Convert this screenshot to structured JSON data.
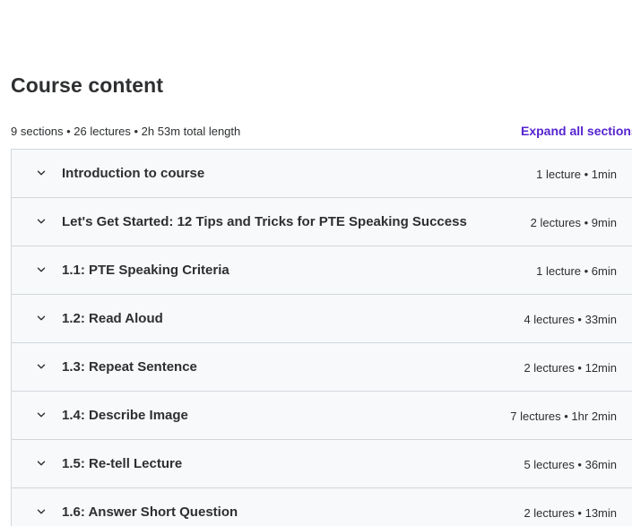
{
  "header": {
    "title": "Course content",
    "summary": "9 sections • 26 lectures • 2h 53m total length",
    "expand_label": "Expand all sections"
  },
  "colors": {
    "accent": "#5624d0",
    "section_bg": "#f7f9fa",
    "border": "#d1d7dc",
    "text": "#2d2f31"
  },
  "icons": {
    "section_toggle": "chevron-down-icon"
  },
  "sections": [
    {
      "title": "Introduction to course",
      "meta": "1 lecture • 1min"
    },
    {
      "title": "Let's Get Started: 12 Tips and Tricks for PTE Speaking Success",
      "meta": "2 lectures • 9min"
    },
    {
      "title": "1.1: PTE Speaking Criteria",
      "meta": "1 lecture • 6min"
    },
    {
      "title": "1.2: Read Aloud",
      "meta": "4 lectures • 33min"
    },
    {
      "title": "1.3: Repeat Sentence",
      "meta": "2 lectures • 12min"
    },
    {
      "title": "1.4: Describe Image",
      "meta": "7 lectures • 1hr 2min"
    },
    {
      "title": "1.5: Re-tell Lecture",
      "meta": "5 lectures • 36min"
    },
    {
      "title": "1.6: Answer Short Question",
      "meta": "2 lectures • 13min"
    }
  ]
}
